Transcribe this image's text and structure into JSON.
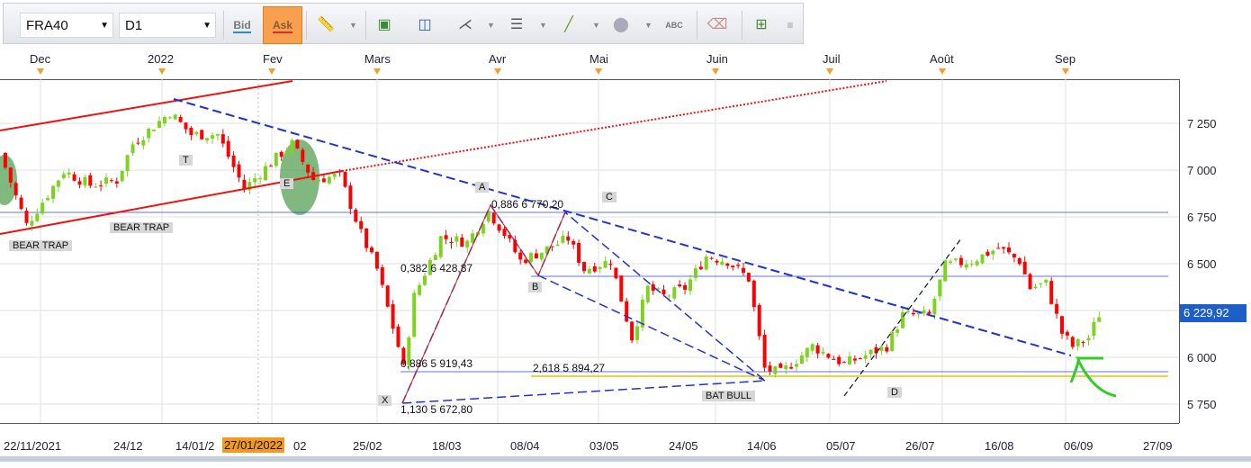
{
  "toolbar": {
    "symbol": "FRA40",
    "timeframe": "D1",
    "bid_label": "Bid",
    "ask_label": "Ask",
    "abc_label": "ABC"
  },
  "top_axis": {
    "months": [
      "Dec",
      "2022",
      "Fev",
      "Mars",
      "Avr",
      "Mai",
      "Juin",
      "Juil",
      "Août",
      "Sep"
    ]
  },
  "price_axis": {
    "labels": [
      "7 250",
      "7 000",
      "6 750",
      "6 500",
      "6 000",
      "5 750"
    ],
    "current_price": "6 229,92",
    "range": [
      5700,
      7450
    ]
  },
  "date_axis": {
    "labels": [
      "22/11/2021",
      "24/12",
      "14/01/2",
      "02",
      "25/02",
      "18/03",
      "08/04",
      "03/05",
      "24/05",
      "14/06",
      "05/07",
      "26/07",
      "16/08",
      "06/09",
      "27/09"
    ],
    "highlight": "27/01/2022"
  },
  "annotations": {
    "bear_trap_1": "BEAR TRAP",
    "bear_trap_2": "BEAR TRAP",
    "t": "T",
    "e": "E",
    "a": "A",
    "b": "B",
    "c": "C",
    "d": "D",
    "x": "X",
    "bat_bull": "BAT BULL",
    "fib_0886_c": "0,886 6 770,20",
    "fib_0382": "0,382 6 428,87",
    "fib_0886_x": "0,886 5 919,43",
    "fib_2618": "2,618 5 894,27",
    "fib_1130": "1,130 5 672,80"
  },
  "chart_data": {
    "type": "candlestick",
    "colors": {
      "up": "#7ed321",
      "down": "#ff0000"
    },
    "anchors": [
      [
        0,
        7090
      ],
      [
        5,
        6707
      ],
      [
        12,
        6995
      ],
      [
        17,
        6920
      ],
      [
        22,
        6945
      ],
      [
        25,
        7140
      ],
      [
        32,
        7308
      ],
      [
        36,
        7190
      ],
      [
        41,
        7190
      ],
      [
        46,
        6900
      ],
      [
        51,
        7040
      ],
      [
        55,
        7140
      ],
      [
        59,
        6950
      ],
      [
        64,
        6970
      ],
      [
        68,
        6660
      ],
      [
        71,
        6470
      ],
      [
        75,
        6058
      ],
      [
        76,
        5940
      ],
      [
        78,
        6325
      ],
      [
        83,
        6640
      ],
      [
        88,
        6615
      ],
      [
        92,
        6780
      ],
      [
        95,
        6660
      ],
      [
        98,
        6515
      ],
      [
        102,
        6565
      ],
      [
        107,
        6635
      ],
      [
        110,
        6470
      ],
      [
        115,
        6515
      ],
      [
        119,
        6105
      ],
      [
        122,
        6370
      ],
      [
        125,
        6325
      ],
      [
        129,
        6370
      ],
      [
        133,
        6540
      ],
      [
        137,
        6515
      ],
      [
        141,
        6420
      ],
      [
        144,
        5940
      ],
      [
        147,
        5915
      ],
      [
        153,
        6060
      ],
      [
        156,
        6010
      ],
      [
        159,
        5965
      ],
      [
        163,
        6010
      ],
      [
        167,
        6060
      ],
      [
        170,
        6225
      ],
      [
        175,
        6225
      ],
      [
        178,
        6490
      ],
      [
        183,
        6515
      ],
      [
        188,
        6585
      ],
      [
        192,
        6515
      ],
      [
        194,
        6370
      ],
      [
        197,
        6395
      ],
      [
        200,
        6130
      ],
      [
        202,
        6058
      ],
      [
        205,
        6105
      ],
      [
        207,
        6230
      ]
    ]
  }
}
